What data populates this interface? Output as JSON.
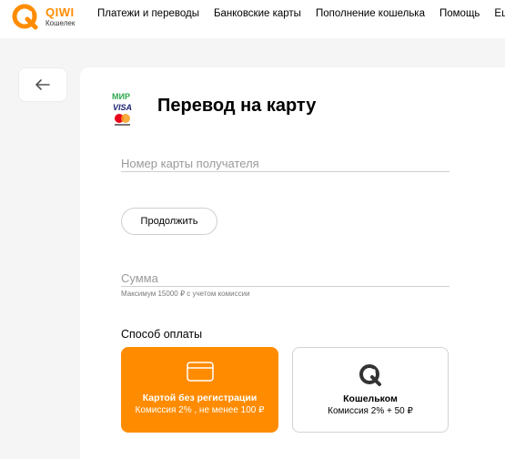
{
  "header": {
    "logo_text": "QIWI",
    "logo_sub": "Кошелек",
    "nav": [
      "Платежи и переводы",
      "Банковские карты",
      "Пополнение кошелька",
      "Помощь",
      "Ещё"
    ]
  },
  "page": {
    "title": "Перевод на карту",
    "card_field_placeholder": "Номер карты получателя",
    "continue_label": "Продолжить",
    "amount_placeholder": "Сумма",
    "amount_hint": "Максимум 15000 ₽ с учетом комиссии",
    "payment_method_label": "Способ оплаты",
    "options": [
      {
        "title": "Картой без регистрации",
        "subtitle": "Комиссия 2% , не менее 100 ₽",
        "icon": "credit-card-icon",
        "selected": true
      },
      {
        "title": "Кошельком",
        "subtitle": "Комиссия 2% + 50 ₽",
        "icon": "qiwi-logo-icon",
        "selected": false
      }
    ],
    "card_brands": [
      "МИР",
      "VISA",
      "mastercard"
    ]
  },
  "colors": {
    "accent": "#ff8c00",
    "background": "#f5f5f5",
    "card": "#ffffff",
    "mir_green": "#2fa84f",
    "visa_blue": "#1a1f71",
    "mc_red": "#eb001b",
    "mc_yellow": "#f79e1b"
  }
}
